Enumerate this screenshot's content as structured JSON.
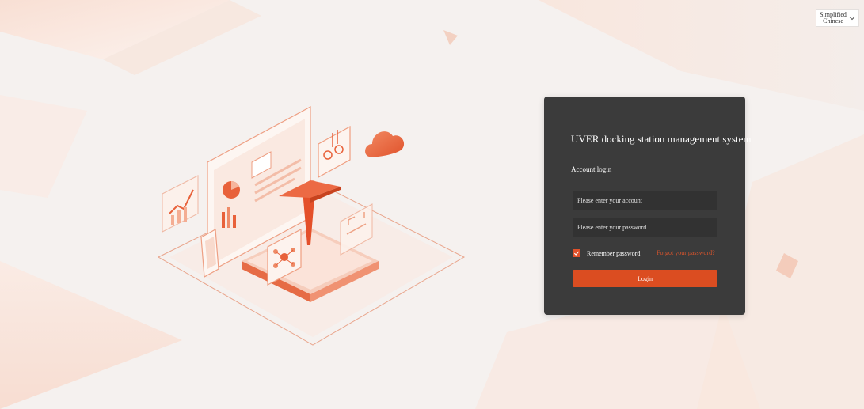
{
  "language_selector": {
    "label": "Simplified Chinese"
  },
  "login_panel": {
    "title": "UVER docking station management system",
    "tab_label": "Account login",
    "account_placeholder": "Please enter your account",
    "password_placeholder": "Please enter your password",
    "remember_label": "Remember password",
    "remember_checked": true,
    "forgot_label": "Forgot your password?",
    "login_label": "Login"
  },
  "colors": {
    "accent": "#db4d21",
    "panel_background": "#3b3b3b",
    "input_background": "#323232",
    "page_background": "#f5f1ef"
  }
}
